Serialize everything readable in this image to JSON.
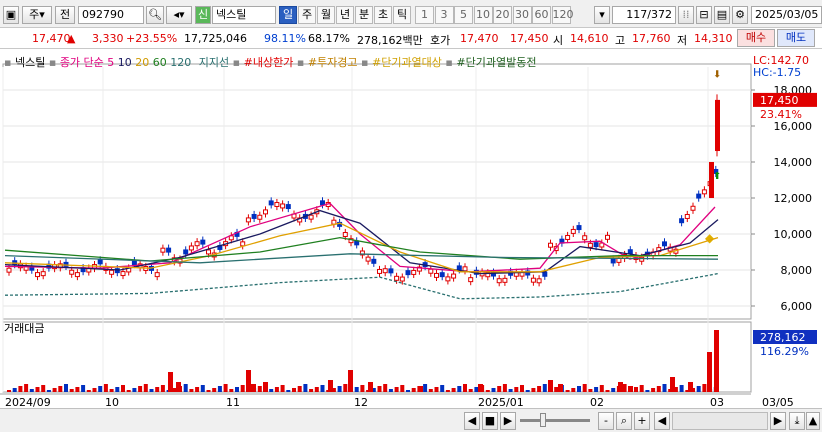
{
  "toolbar": {
    "market": "주",
    "type": "전",
    "code": "092790",
    "badge": "신",
    "name": "넥스틸",
    "periods": [
      "일",
      "주",
      "월",
      "년",
      "분",
      "초",
      "틱"
    ],
    "active_period": "일",
    "intervals": [
      "1",
      "3",
      "5",
      "10",
      "20",
      "30",
      "60",
      "120"
    ],
    "page": "117",
    "page_total": "/372",
    "date": "2025/03/05"
  },
  "quote": {
    "price": "17,470",
    "arrow": "▲",
    "change": "3,330",
    "pct": "+23.55%",
    "volume": "17,725,046",
    "ratio1": "98.11%",
    "ratio2": "68.17%",
    "amount": "278,162백만",
    "hoga_label": "호가",
    "hoga1": "17,470",
    "hoga2": "17,450",
    "open_label": "시",
    "open": "14,610",
    "high_label": "고",
    "high": "17,760",
    "low_label": "저",
    "low": "14,310",
    "buy_label": "매수",
    "sell_label": "매도"
  },
  "legend": {
    "stock": "넥스틸",
    "ma_title": "종가 단순",
    "ma5": "5",
    "ma10": "10",
    "ma20": "20",
    "ma60": "60",
    "ma120": "120",
    "support": "지지선",
    "up_limit": "#내상한가",
    "warn": "#투자경고",
    "overheat": "#단기과열대상",
    "overheat2": "#단기과열발동전",
    "lc": "LC:142.70",
    "hc": "HC:-1.75",
    "vol_title": "거래대금"
  },
  "axis": {
    "price_ticks": [
      "18,000",
      "16,000",
      "14,000",
      "12,000",
      "10,000",
      "8,000",
      "6,000"
    ],
    "price_label": "17,450",
    "price_pct": "23.41%",
    "vol_label": "278,162",
    "vol_pct": "116.29%",
    "x_labels": [
      "2024/09",
      "10",
      "11",
      "12",
      "2025/01",
      "02",
      "03",
      "03/05"
    ]
  },
  "colors": {
    "up": "#e00000",
    "down": "#0030c0",
    "ma5": "#e0007f",
    "ma10": "#1a1a60",
    "ma20": "#e0a000",
    "ma60": "#208020",
    "ma120": "#2a7070"
  },
  "chart_data": {
    "type": "candlestick",
    "title": "넥스틸",
    "y_ticks": [
      6000,
      8000,
      10000,
      12000,
      14000,
      16000,
      18000
    ],
    "ylim": [
      5000,
      19000
    ],
    "x_ticks": [
      "2024/09",
      "10",
      "11",
      "12",
      "2025/01",
      "02",
      "03"
    ],
    "last_close": 17450,
    "last_change_pct": 23.41,
    "last_trade_value": 278162
  }
}
